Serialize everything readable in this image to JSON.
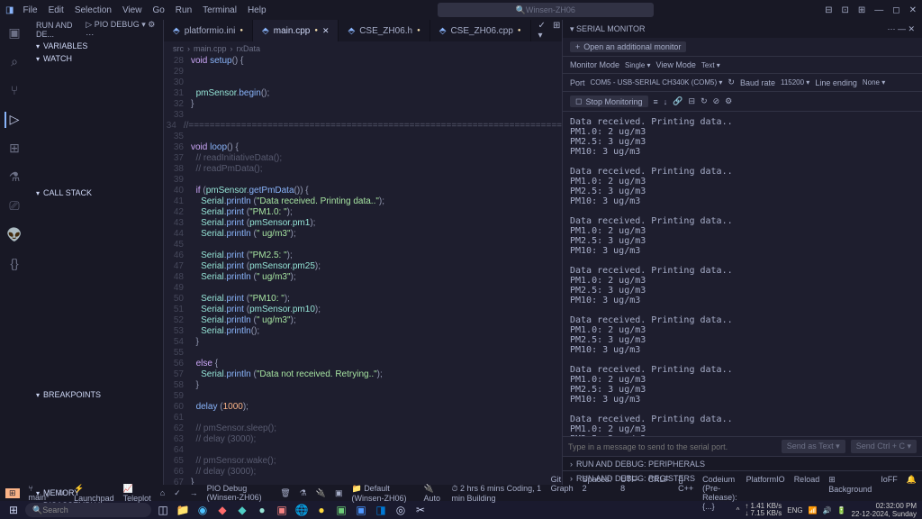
{
  "titlebar": {
    "menu": [
      "File",
      "Edit",
      "Selection",
      "View",
      "Go",
      "Run",
      "Terminal",
      "Help"
    ],
    "search": "Winsen-ZH06",
    "logo": "⊞"
  },
  "sidebar": {
    "header": "RUN AND DE...",
    "launch": "PIO Debug",
    "sections": [
      "VARIABLES",
      "WATCH",
      "CALL STACK",
      "BREAKPOINTS",
      "MEMORY",
      "DISASSEMBLY"
    ]
  },
  "tabs": [
    {
      "name": "platformio.ini",
      "modified": true
    },
    {
      "name": "main.cpp",
      "modified": true,
      "active": true
    },
    {
      "name": "CSE_ZH06.h",
      "modified": true
    },
    {
      "name": "CSE_ZH06.cpp",
      "modified": true
    }
  ],
  "crumb": [
    "src",
    "main.cpp",
    "rxData"
  ],
  "code": [
    {
      "n": 28,
      "t": [
        [
          "kw",
          "void "
        ],
        [
          "fn",
          "setup"
        ],
        [
          "punc",
          "() {"
        ]
      ]
    },
    {
      "n": 29,
      "t": [
        [
          "",
          ""
        ]
      ]
    },
    {
      "n": 30,
      "t": [
        [
          "",
          ""
        ]
      ]
    },
    {
      "n": 31,
      "t": [
        [
          "",
          "  "
        ],
        [
          "var",
          "pmSensor"
        ],
        [
          "punc",
          "."
        ],
        [
          "fn",
          "begin"
        ],
        [
          "punc",
          "();"
        ]
      ]
    },
    {
      "n": 32,
      "t": [
        [
          "punc",
          "}"
        ]
      ]
    },
    {
      "n": 33,
      "t": [
        [
          "",
          ""
        ]
      ]
    },
    {
      "n": 34,
      "t": [
        [
          "cm",
          "//======================================================================="
        ]
      ]
    },
    {
      "n": 35,
      "t": [
        [
          "",
          ""
        ]
      ]
    },
    {
      "n": 36,
      "t": [
        [
          "kw",
          "void "
        ],
        [
          "fn",
          "loop"
        ],
        [
          "punc",
          "() {"
        ]
      ]
    },
    {
      "n": 37,
      "t": [
        [
          "cm",
          "  // readInitiativeData();"
        ]
      ]
    },
    {
      "n": 38,
      "t": [
        [
          "cm",
          "  // readPmData();"
        ]
      ]
    },
    {
      "n": 39,
      "t": [
        [
          "",
          ""
        ]
      ]
    },
    {
      "n": 40,
      "t": [
        [
          "",
          "  "
        ],
        [
          "kw",
          "if "
        ],
        [
          "punc",
          "("
        ],
        [
          "var",
          "pmSensor"
        ],
        [
          "punc",
          "."
        ],
        [
          "fn",
          "getPmData"
        ],
        [
          "punc",
          "()) {"
        ]
      ]
    },
    {
      "n": 41,
      "t": [
        [
          "",
          "    "
        ],
        [
          "var",
          "Serial"
        ],
        [
          "punc",
          "."
        ],
        [
          "fn",
          "println "
        ],
        [
          "punc",
          "("
        ],
        [
          "str",
          "\"Data received. Printing data..\""
        ],
        [
          "punc",
          ");"
        ]
      ]
    },
    {
      "n": 42,
      "t": [
        [
          "",
          "    "
        ],
        [
          "var",
          "Serial"
        ],
        [
          "punc",
          "."
        ],
        [
          "fn",
          "print "
        ],
        [
          "punc",
          "("
        ],
        [
          "str",
          "\"PM1.0: \""
        ],
        [
          "punc",
          ");"
        ]
      ]
    },
    {
      "n": 43,
      "t": [
        [
          "",
          "    "
        ],
        [
          "var",
          "Serial"
        ],
        [
          "punc",
          "."
        ],
        [
          "fn",
          "print "
        ],
        [
          "punc",
          "("
        ],
        [
          "var",
          "pmSensor"
        ],
        [
          "punc",
          "."
        ],
        [
          "var",
          "pm1"
        ],
        [
          "punc",
          ");"
        ]
      ]
    },
    {
      "n": 44,
      "t": [
        [
          "",
          "    "
        ],
        [
          "var",
          "Serial"
        ],
        [
          "punc",
          "."
        ],
        [
          "fn",
          "println "
        ],
        [
          "punc",
          "("
        ],
        [
          "str",
          "\" ug/m3\""
        ],
        [
          "punc",
          ");"
        ]
      ]
    },
    {
      "n": 45,
      "t": [
        [
          "",
          ""
        ]
      ]
    },
    {
      "n": 46,
      "t": [
        [
          "",
          "    "
        ],
        [
          "var",
          "Serial"
        ],
        [
          "punc",
          "."
        ],
        [
          "fn",
          "print "
        ],
        [
          "punc",
          "("
        ],
        [
          "str",
          "\"PM2.5: \""
        ],
        [
          "punc",
          ");"
        ]
      ]
    },
    {
      "n": 47,
      "t": [
        [
          "",
          "    "
        ],
        [
          "var",
          "Serial"
        ],
        [
          "punc",
          "."
        ],
        [
          "fn",
          "print "
        ],
        [
          "punc",
          "("
        ],
        [
          "var",
          "pmSensor"
        ],
        [
          "punc",
          "."
        ],
        [
          "var",
          "pm25"
        ],
        [
          "punc",
          ");"
        ]
      ]
    },
    {
      "n": 48,
      "t": [
        [
          "",
          "    "
        ],
        [
          "var",
          "Serial"
        ],
        [
          "punc",
          "."
        ],
        [
          "fn",
          "println "
        ],
        [
          "punc",
          "("
        ],
        [
          "str",
          "\" ug/m3\""
        ],
        [
          "punc",
          ");"
        ]
      ]
    },
    {
      "n": 49,
      "t": [
        [
          "",
          ""
        ]
      ]
    },
    {
      "n": 50,
      "t": [
        [
          "",
          "    "
        ],
        [
          "var",
          "Serial"
        ],
        [
          "punc",
          "."
        ],
        [
          "fn",
          "print "
        ],
        [
          "punc",
          "("
        ],
        [
          "str",
          "\"PM10: \""
        ],
        [
          "punc",
          ");"
        ]
      ]
    },
    {
      "n": 51,
      "t": [
        [
          "",
          "    "
        ],
        [
          "var",
          "Serial"
        ],
        [
          "punc",
          "."
        ],
        [
          "fn",
          "print "
        ],
        [
          "punc",
          "("
        ],
        [
          "var",
          "pmSensor"
        ],
        [
          "punc",
          "."
        ],
        [
          "var",
          "pm10"
        ],
        [
          "punc",
          ");"
        ]
      ]
    },
    {
      "n": 52,
      "t": [
        [
          "",
          "    "
        ],
        [
          "var",
          "Serial"
        ],
        [
          "punc",
          "."
        ],
        [
          "fn",
          "println "
        ],
        [
          "punc",
          "("
        ],
        [
          "str",
          "\" ug/m3\""
        ],
        [
          "punc",
          ");"
        ]
      ]
    },
    {
      "n": 53,
      "t": [
        [
          "",
          "    "
        ],
        [
          "var",
          "Serial"
        ],
        [
          "punc",
          "."
        ],
        [
          "fn",
          "println"
        ],
        [
          "punc",
          "();"
        ]
      ]
    },
    {
      "n": 54,
      "t": [
        [
          "punc",
          "  }"
        ]
      ]
    },
    {
      "n": 55,
      "t": [
        [
          "",
          ""
        ]
      ]
    },
    {
      "n": 56,
      "t": [
        [
          "",
          "  "
        ],
        [
          "kw",
          "else "
        ],
        [
          "punc",
          "{"
        ]
      ]
    },
    {
      "n": 57,
      "t": [
        [
          "",
          "    "
        ],
        [
          "var",
          "Serial"
        ],
        [
          "punc",
          "."
        ],
        [
          "fn",
          "println "
        ],
        [
          "punc",
          "("
        ],
        [
          "str",
          "\"Data not received. Retrying..\""
        ],
        [
          "punc",
          ");"
        ]
      ]
    },
    {
      "n": 58,
      "t": [
        [
          "punc",
          "  }"
        ]
      ]
    },
    {
      "n": 59,
      "t": [
        [
          "",
          ""
        ]
      ]
    },
    {
      "n": 60,
      "t": [
        [
          "",
          "  "
        ],
        [
          "fn",
          "delay "
        ],
        [
          "punc",
          "("
        ],
        [
          "num",
          "1000"
        ],
        [
          "punc",
          ");"
        ]
      ]
    },
    {
      "n": 61,
      "t": [
        [
          "",
          ""
        ]
      ]
    },
    {
      "n": 62,
      "t": [
        [
          "cm",
          "  // pmSensor.sleep();"
        ]
      ]
    },
    {
      "n": 63,
      "t": [
        [
          "cm",
          "  // delay (3000);"
        ]
      ]
    },
    {
      "n": 64,
      "t": [
        [
          "",
          ""
        ]
      ]
    },
    {
      "n": 65,
      "t": [
        [
          "cm",
          "  // pmSensor.wake();"
        ]
      ]
    },
    {
      "n": 66,
      "t": [
        [
          "cm",
          "  // delay (3000);"
        ]
      ]
    },
    {
      "n": 67,
      "t": [
        [
          "punc",
          "}"
        ]
      ]
    }
  ],
  "serial": {
    "title": "SERIAL MONITOR",
    "open_additional": "Open an additional monitor",
    "monitor_mode": "Monitor Mode",
    "monitor_mode_val": "Single",
    "view_mode": "View Mode",
    "view_mode_val": "Text",
    "port_lbl": "Port",
    "port": "COM5 - USB-SERIAL CH340K (COM5)",
    "baud_lbl": "Baud rate",
    "baud": "115200",
    "line_lbl": "Line ending",
    "line": "None",
    "stop": "Stop Monitoring",
    "block": "Data received. Printing data..\nPM1.0: 2 ug/m3\nPM2.5: 3 ug/m3\nPM10: 3 ug/m3",
    "input_placeholder": "Type in a message to send to the serial port.",
    "send_text": "Send as Text",
    "send_ctrl": "Send Ctrl + C",
    "accord1": "RUN AND DEBUG: PERIPHERALS",
    "accord2": "RUN AND DEBUG: REGISTERS"
  },
  "status": {
    "remote": "⊞",
    "branch": "main*",
    "sync": "↻",
    "launchpad": "Launchpad",
    "teleplot": "Teleplot",
    "debug": "PIO Debug (Winsen-ZH06)",
    "default": "Default (Winsen-ZH06)",
    "auto": "Auto",
    "time": "2 hrs 6 mins Coding, 1 min Building",
    "git": "Git Graph",
    "spaces": "Spaces: 2",
    "enc": "UTF-8",
    "crlf": "CRLF",
    "lang": "C++",
    "codeium": "Codeium (Pre-Release): {...}",
    "platformio": "PlatformIO",
    "reload": "Reload",
    "bg": "Background",
    "ioff": "IoFF"
  },
  "taskbar": {
    "search": "Search",
    "time": "02:32:00 PM",
    "date": "22-12-2024, Sunday",
    "net": "↑ 1.41 KB/s\n↓ 7.15 KB/s"
  }
}
